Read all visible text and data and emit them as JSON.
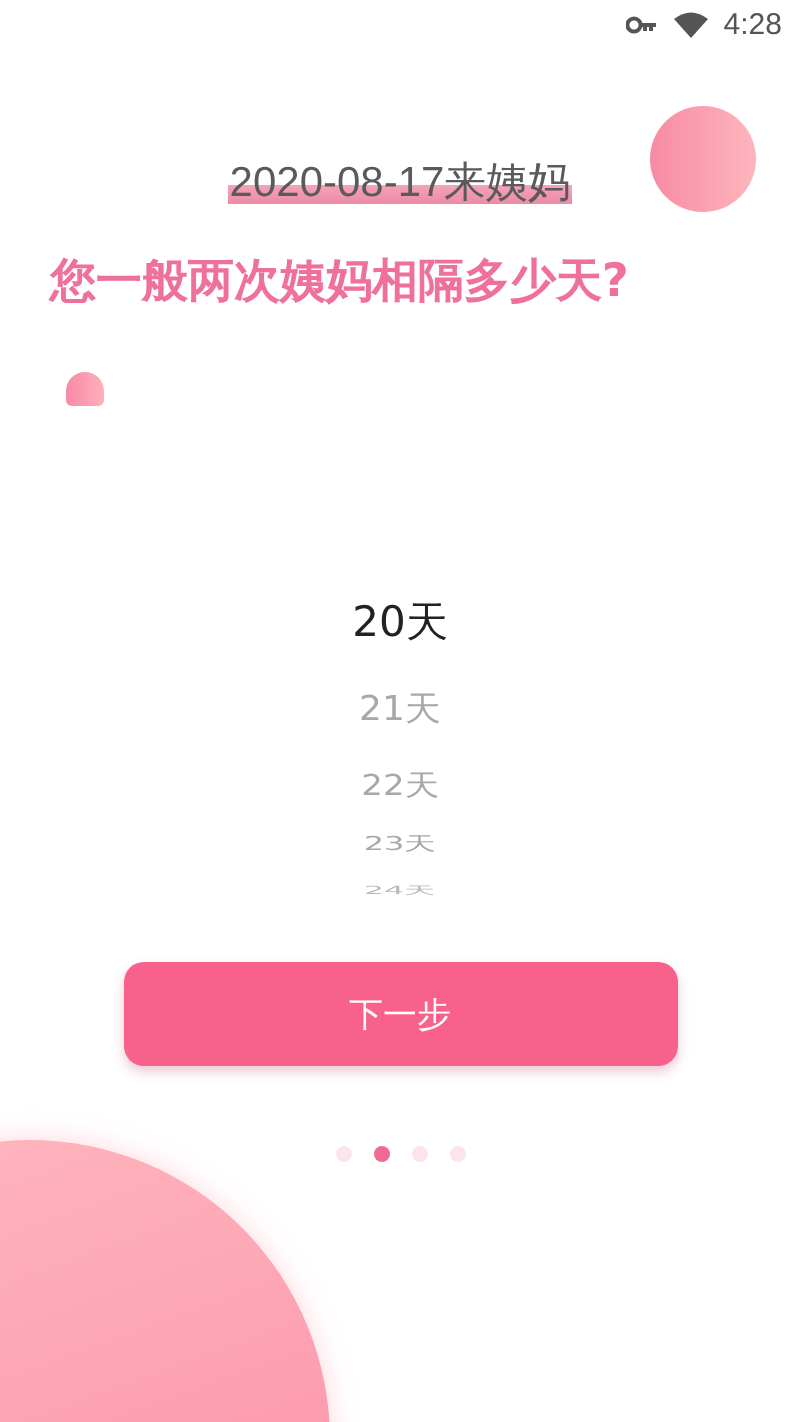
{
  "status_bar": {
    "time": "4:28"
  },
  "date_label": "2020-08-17来姨妈",
  "question": "您一般两次姨妈相隔多少天?",
  "picker": [
    {
      "label": "20天",
      "selected": true
    },
    {
      "label": "21天",
      "selected": false
    },
    {
      "label": "22天",
      "selected": false
    },
    {
      "label": "23天",
      "selected": false
    },
    {
      "label": "24天",
      "selected": false
    }
  ],
  "next_button": "下一步",
  "page_dots": [
    {
      "selected": false
    },
    {
      "selected": true
    },
    {
      "selected": false
    },
    {
      "selected": false
    }
  ]
}
